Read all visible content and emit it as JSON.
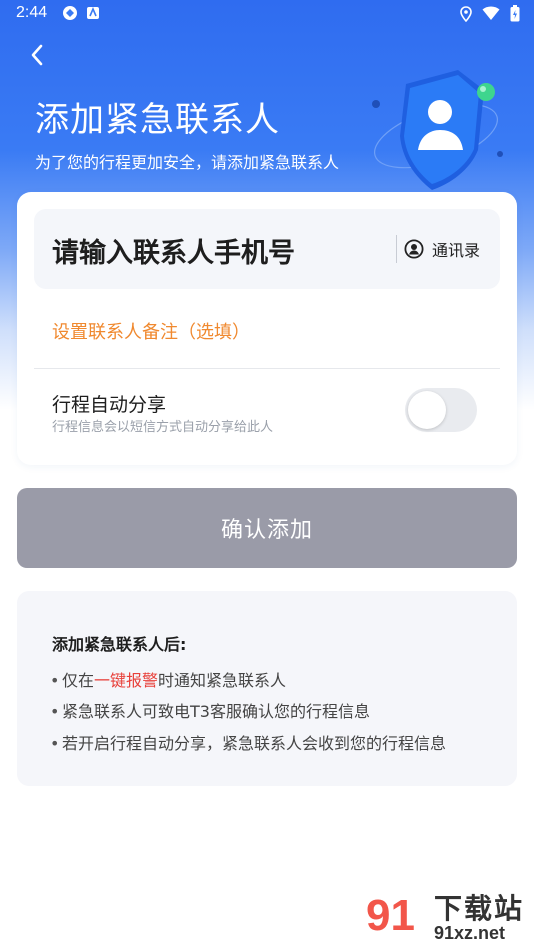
{
  "status_bar": {
    "time": "2:44",
    "left_icons": [
      "vpn-icon",
      "app-icon"
    ],
    "right_icons": [
      "location-icon",
      "wifi-icon",
      "battery-icon"
    ]
  },
  "header": {
    "title": "添加紧急联系人",
    "subtitle": "为了您的行程更加安全，请添加紧急联系人",
    "illustration": "shield-user-icon"
  },
  "form": {
    "phone_placeholder": "请输入联系人手机号",
    "contacts_label": "通讯录",
    "contacts_icon": "contact-person-icon",
    "note_placeholder": "设置联系人备注（选填）",
    "auto_share_title": "行程自动分享",
    "auto_share_desc": "行程信息会以短信方式自动分享给此人",
    "auto_share_enabled": false
  },
  "confirm_button_label": "确认添加",
  "info": {
    "title": "添加紧急联系人后:",
    "item1_prefix": "仅在",
    "item1_highlight": "一键报警",
    "item1_suffix": "时通知紧急联系人",
    "item2": "紧急联系人可致电T3客服确认您的行程信息",
    "item3": "若开启行程自动分享，紧急联系人会收到您的行程信息"
  },
  "watermark": {
    "number": "91",
    "top_text": "下载站",
    "bottom_text": "91xz.net"
  },
  "colors": {
    "header_blue": "#2f6cf0",
    "note_orange": "#f0892f",
    "highlight_red": "#e8403a",
    "button_disabled": "#9a9ba8"
  }
}
